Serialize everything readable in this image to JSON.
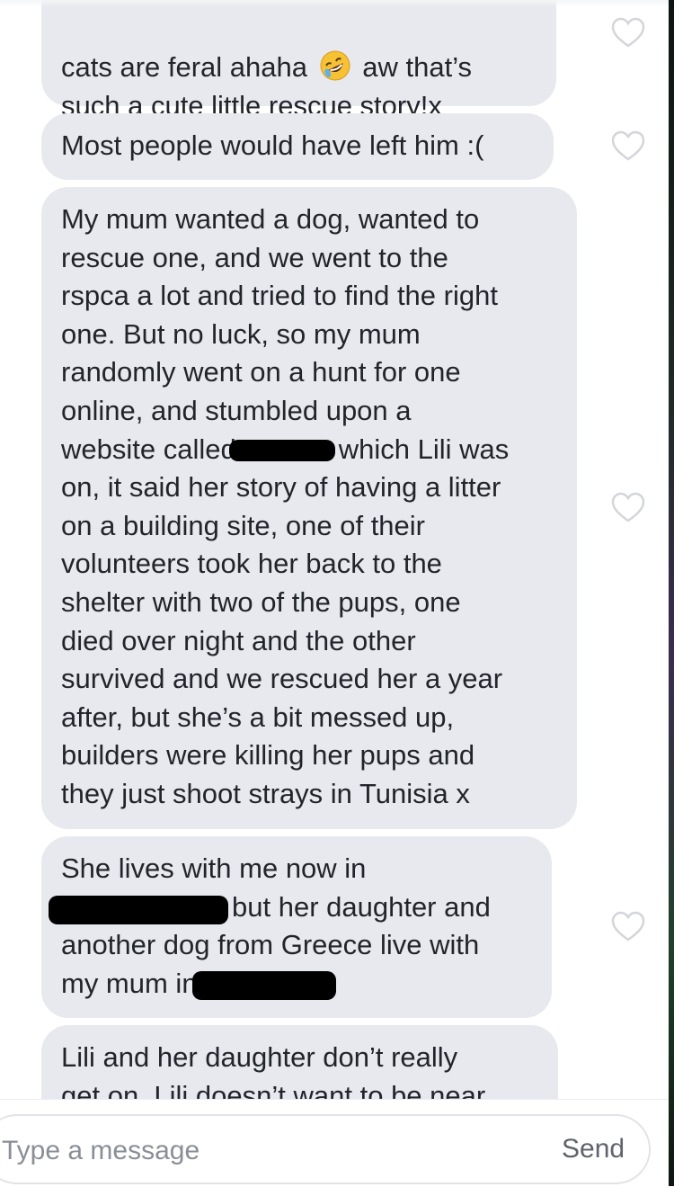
{
  "messages": [
    {
      "lines": [
        "cats are feral ahaha",
        "aw that’s",
        "such a cute little rescue story!x"
      ],
      "emoji": "rolling-on-floor-laughing-emoji"
    },
    {
      "lines": [
        "Most people would have left him :("
      ]
    },
    {
      "lines": [
        "My mum wanted a dog, wanted to",
        "rescue one, and we went to the",
        "rspca a lot and tried to find the right",
        "one. But no luck, so my mum",
        "randomly went on a hunt for one",
        "online, and stumbled upon a",
        "website called",
        "which Lili was",
        "on, it said her story of having a litter",
        "on a building site, one of their",
        "volunteers took her back to the",
        "shelter with two of the pups, one",
        "died over night and the other",
        "survived and we rescued her a year",
        "after, but she’s a bit messed up,",
        "builders were killing her pups and",
        "they just shoot strays in Tunisia x"
      ]
    },
    {
      "lines": [
        "She lives with me now in",
        "but her daughter and",
        "another dog from Greece live with",
        "my mum in"
      ]
    },
    {
      "lines": [
        "Lili and her daughter don’t really",
        "get on. Lili doesn’t want to be near"
      ]
    }
  ],
  "composer": {
    "placeholder": "Type a message",
    "send_label": "Send"
  },
  "colors": {
    "bubble": "#e8e9ee",
    "text": "#21252b",
    "heart_outline": "#d4d5da",
    "redaction": "#000000"
  }
}
